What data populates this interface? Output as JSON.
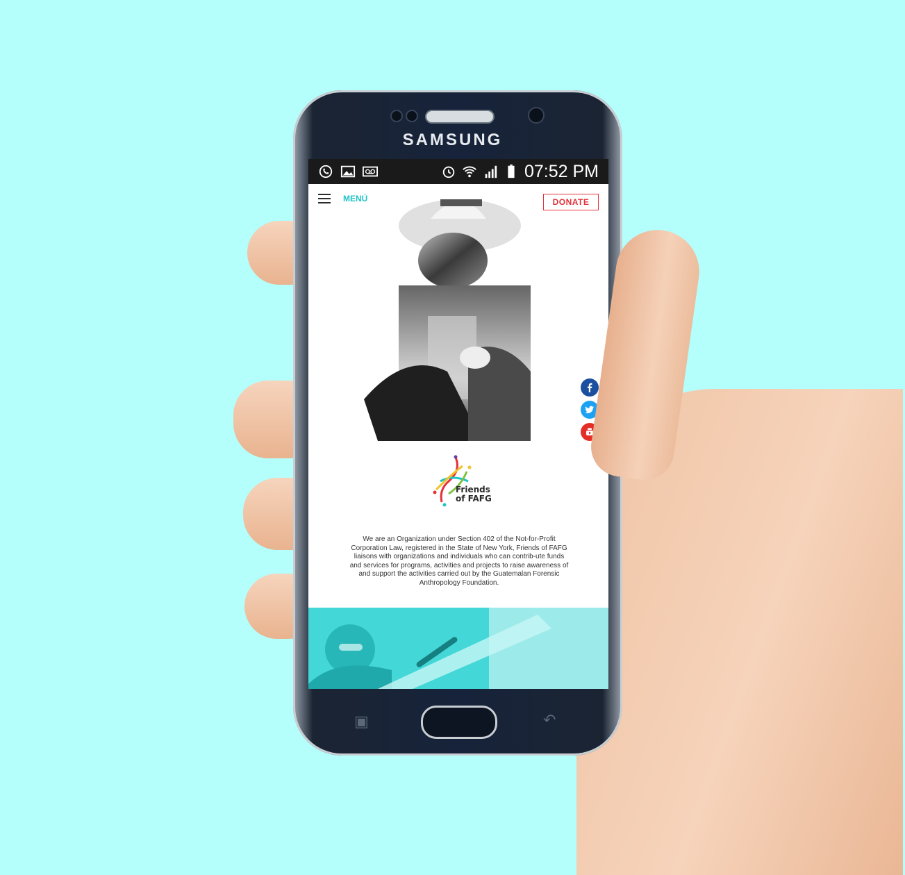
{
  "device": {
    "brand": "SAMSUNG"
  },
  "status_bar": {
    "left_icons": [
      "whatsapp-icon",
      "gallery-icon",
      "voicemail-icon"
    ],
    "right_icons": [
      "alarm-icon",
      "wifi-icon",
      "signal-icon",
      "battery-icon"
    ],
    "time": "07:52 PM"
  },
  "site": {
    "menu_label": "MENÚ",
    "donate_label": "DONATE",
    "logo_lines": [
      "Friends",
      "of FAFG"
    ],
    "about": "We are an Organization under Section 402 of the Not-for-Profit Corporation Law, registered in the State of New York, Friends of FAFG liaisons with organizations and individuals who can contrib-ute funds and services for programs, activities and projects to raise awareness of and support the activities carried out by the Guatemalan Forensic Anthropology Foundation.",
    "social": [
      {
        "name": "facebook-icon",
        "color": "#1b4fa0"
      },
      {
        "name": "twitter-icon",
        "color": "#1da1f2"
      },
      {
        "name": "youtube-icon",
        "color": "#e52d27"
      }
    ],
    "accent_color": "#1fc4c7",
    "donate_color": "#e3323a"
  }
}
